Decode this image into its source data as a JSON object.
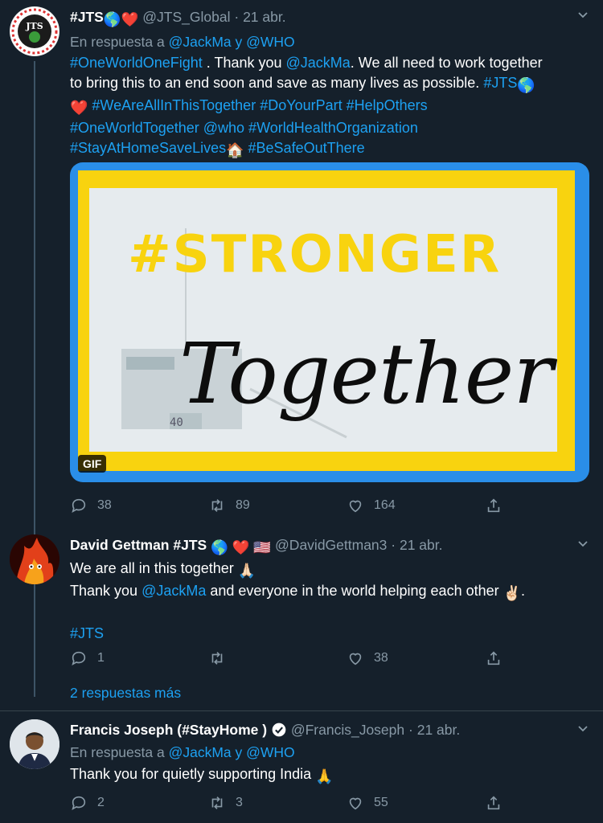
{
  "tweets": [
    {
      "name": "#JTS",
      "name_emoji": "🌎❤️",
      "handle": "@JTS_Global",
      "date": "21 abr.",
      "reply_prefix": "En respuesta a",
      "reply_targets": "@JackMa y @WHO",
      "text": {
        "l1_tag": "#OneWorldOneFight",
        "l1_a": " . Thank you ",
        "l1_mention": "@JackMa",
        "l1_b": ". We all need to work together",
        "l2_a": "to bring this to an end soon and save as many lives as possible. ",
        "l2_tag": "#JTS",
        "l2_emoji": "🌎",
        "l3_emoji": "❤️",
        "l3_tags": " #WeAreAllInThisTogether #DoYourPart #HelpOthers",
        "l4_tags": "#OneWorldTogether @who #WorldHealthOrganization",
        "l5_tag": "#StayAtHomeSaveLives",
        "l5_emoji": "🏠",
        "l5_tag2": " #BeSafeOutThere"
      },
      "gif": {
        "line1": "#STRONGER",
        "line2": "Together",
        "badge": "GIF"
      },
      "stats": {
        "replies": "38",
        "retweets": "89",
        "likes": "164"
      }
    },
    {
      "name": "David Gettman #JTS",
      "name_emoji": "🌎 ❤️ 🇺🇸",
      "handle": "@DavidGettman3",
      "date": "21 abr.",
      "line1": "We are all in this together",
      "line1_emoji": "🙏🏻",
      "line2_a": "Thank you ",
      "line2_mention": "@JackMa",
      "line2_b": " and everyone in the world helping each other",
      "line2_emoji": "✌🏻",
      "line2_end": ".",
      "hashtag": "#JTS",
      "stats": {
        "replies": "1",
        "retweets": "",
        "likes": "38"
      }
    },
    {
      "more_replies": "2 respuestas más"
    },
    {
      "name": "Francis Joseph (#StayHome )",
      "handle": "@Francis_Joseph",
      "date": "21 abr.",
      "reply_prefix": "En respuesta a",
      "reply_targets": "@JackMa y @WHO",
      "text": "Thank you for quietly supporting India",
      "text_emoji": "🙏",
      "stats": {
        "replies": "2",
        "retweets": "3",
        "likes": "55"
      }
    }
  ],
  "colors": {
    "background": "#15202b",
    "link": "#1da1f2",
    "muted": "#8899a6",
    "heart": "#e0245e"
  },
  "icons": [
    "chevron-down-icon",
    "reply-icon",
    "retweet-icon",
    "like-icon",
    "share-icon",
    "verified-icon"
  ]
}
